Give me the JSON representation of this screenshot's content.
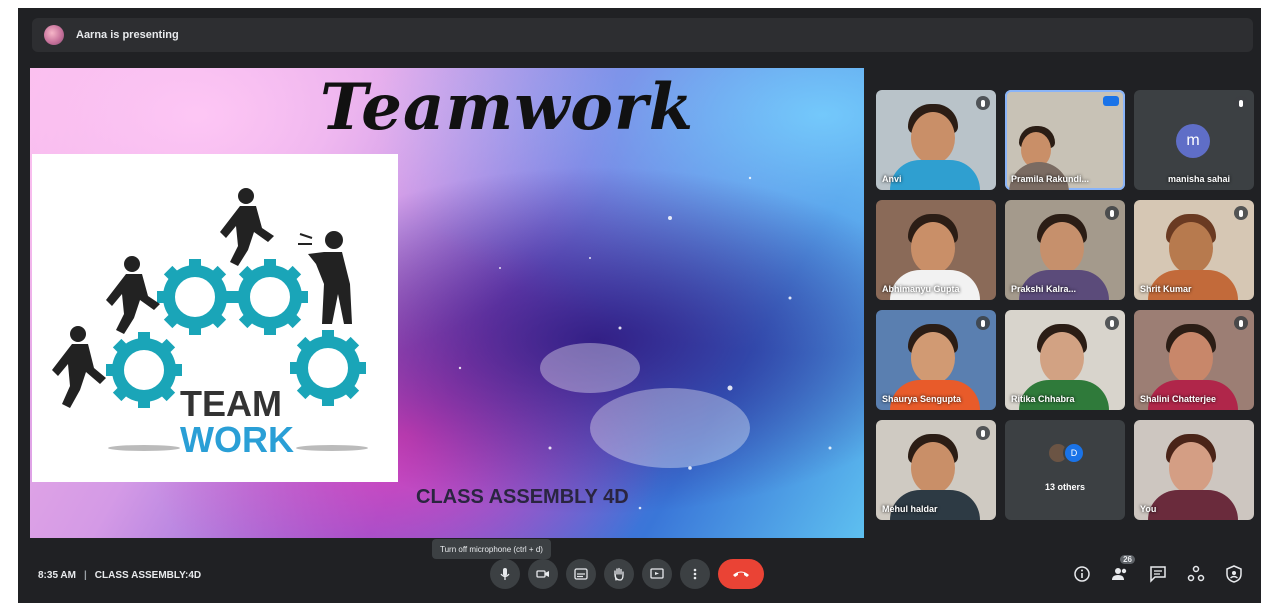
{
  "presenter_bar": {
    "text": "Aarna is presenting"
  },
  "slide": {
    "title": "Teamwork",
    "caption": "CLASS ASSEMBLY 4D",
    "logo_line1": "TEAM",
    "logo_line2": "WORK"
  },
  "participants": [
    {
      "name": "Anvi",
      "shirt": "#2f9fd0",
      "speaking": false
    },
    {
      "name": "Pramila Rakundi...",
      "shirt": "#7a6b62",
      "speaking": true
    },
    {
      "name": "manisha sahai",
      "initial": "m"
    },
    {
      "name": "Abhimanyu Gupta",
      "shirt": "#f2f2f2",
      "speaking": false
    },
    {
      "name": "Prakshi Kalra...",
      "shirt": "#5b4b7a",
      "speaking": false
    },
    {
      "name": "Shrit Kumar",
      "shirt": "#c26a3a",
      "speaking": false
    },
    {
      "name": "Shaurya Sengupta",
      "shirt": "#e85b2a",
      "speaking": false
    },
    {
      "name": "Ritika Chhabra",
      "shirt": "#2f7a3a",
      "speaking": false
    },
    {
      "name": "Shalini Chatterjee",
      "shirt": "#b0264a",
      "speaking": false
    },
    {
      "name": "Mehul haldar",
      "shirt": "#2d3a44",
      "speaking": false
    },
    {
      "name": "13 others",
      "initial": "D"
    },
    {
      "name": "You",
      "shirt": "#6a2b3c",
      "speaking": false
    }
  ],
  "bottom_bar": {
    "time": "8:35 AM",
    "meeting_name": "CLASS ASSEMBLY:4D",
    "tooltip": "Turn off microphone (ctrl + d)",
    "participant_count": "26"
  },
  "icons": {
    "mic": "microphone-icon",
    "camera": "camera-icon",
    "captions": "captions-icon",
    "hand": "raise-hand-icon",
    "present": "present-screen-icon",
    "more": "more-options-icon",
    "hangup": "hang-up-icon",
    "info": "info-icon",
    "people": "people-icon",
    "chat": "chat-icon",
    "activities": "activities-icon",
    "host": "host-controls-icon"
  },
  "colors": {
    "hangup_red": "#ea4335",
    "gear_teal": "#1aa5b8",
    "work_blue": "#2a9fd6",
    "speaking_outline": "#8ab4f8"
  }
}
